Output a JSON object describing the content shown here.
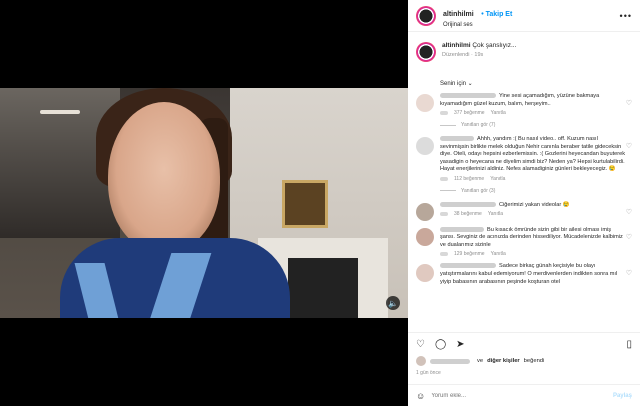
{
  "post": {
    "username": "altinhilmi",
    "follow_label": "Takip Et",
    "audio": "Orijinal ses",
    "caption": "Çok şanslıyız...",
    "caption_meta": "Düzenlendi · 19s"
  },
  "sort_label": "Senin için ⌄",
  "comments": [
    {
      "text": "Yine sesi açamadığım, yüzüne bakmaya kıyamadığım güzel kuzum, balım, herşeyim..",
      "likes": "377 beğenme",
      "reply": "Yanıtla",
      "replies_link": "Yanıtları gör (7)"
    },
    {
      "text": "Ahhh, yandım :( Bu nasıl video.. off. Kuzum nasıl sevinmişsin birlikte melek olduğun Nehir canınla beraber tatile gideceksin diye. Oteli, odayı hepsini ezberlemissin. :( Gozlerini heyecandan buyuterek yasadigin o heyecana ne diyelim simdi biz? Neden ya? Hepsi kurtulabilirdi. Hayat enerjilerinizi aldiniz. Nefes alamadiginiz günleri bekleyecegiz. 😢",
      "likes": "112 beğenme",
      "reply": "Yanıtla",
      "replies_link": "Yanıtları gör (3)"
    },
    {
      "text": "Ciğerimizi yakan videolar 😢",
      "likes": "38 beğenme",
      "reply": "Yanıtla"
    },
    {
      "text": "Bu kısacık ömründe sizin gibi bir ailesi olması imiş şansı. Sevginiz de acınızda derinden hissediliyor. Mücadelenizde kalbimiz ve dualarımız sizinle",
      "likes": "129 beğenme",
      "reply": "Yanıtla"
    },
    {
      "text": "Sadece birkaç günah keçisiyle bu olayı yatıştırmalarını kabul edemiyorum! O merdivenlerden indikten sonra mıl yiyip babasının arabasının peşinde koşturan otel",
      "likes": "",
      "reply": ""
    }
  ],
  "likes_line": {
    "suffix": "ve",
    "bold": "diğer kişiler",
    "tail": "beğendi"
  },
  "posted_when": "1 gün önce",
  "add_comment": {
    "placeholder": "Yorum ekle...",
    "post_label": "Paylaş"
  },
  "icons": {
    "more": "more-icon",
    "heart": "heart-icon",
    "comment": "comment-icon",
    "share": "share-icon",
    "save": "bookmark-icon",
    "emoji": "emoji-icon",
    "mute": "speaker-icon"
  },
  "colors": {
    "link_blue": "#0095f6",
    "muted": "#8e8e8e",
    "text": "#262626"
  }
}
